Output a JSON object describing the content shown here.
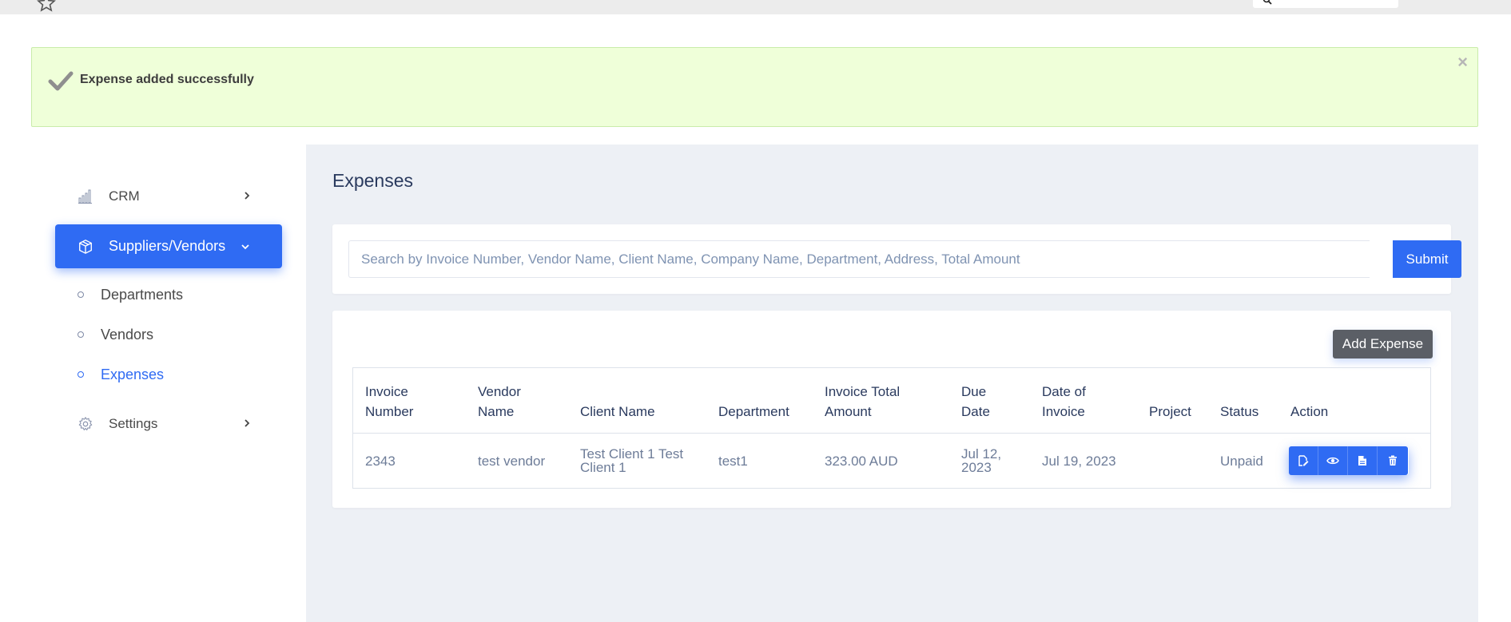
{
  "alert": {
    "message": "Expense added successfully",
    "close_label": "×"
  },
  "sidebar": {
    "items": [
      {
        "label": "CRM",
        "icon": "bar-chart-icon"
      },
      {
        "label": "Suppliers/Vendors",
        "icon": "box-icon"
      },
      {
        "label": "Settings",
        "icon": "gear-icon"
      }
    ],
    "sub_items": [
      {
        "label": "Departments"
      },
      {
        "label": "Vendors"
      },
      {
        "label": "Expenses"
      }
    ]
  },
  "main": {
    "title": "Expenses",
    "search": {
      "placeholder": "Search by Invoice Number, Vendor Name, Client Name, Company Name, Department, Address, Total Amount",
      "value": "",
      "submit_label": "Submit"
    },
    "add_label": "Add Expense",
    "table": {
      "headers": [
        "Invoice Number",
        "Vendor Name",
        "Client Name",
        "Department",
        "Invoice Total Amount",
        "Due Date",
        "Date of Invoice",
        "Project",
        "Status",
        "Action"
      ],
      "rows": [
        {
          "invoice_number": "2343",
          "vendor_name": "test vendor",
          "client_name": "Test Client 1 Test Client 1",
          "department": "test1",
          "total": "323.00 AUD",
          "due_date": "Jul 12, 2023",
          "invoice_date": "Jul 19, 2023",
          "project": "",
          "status": "Unpaid"
        }
      ]
    }
  },
  "colors": {
    "accent": "#2f6bf3",
    "alert_bg": "#efffd9",
    "panel_bg": "#edf0f5"
  }
}
